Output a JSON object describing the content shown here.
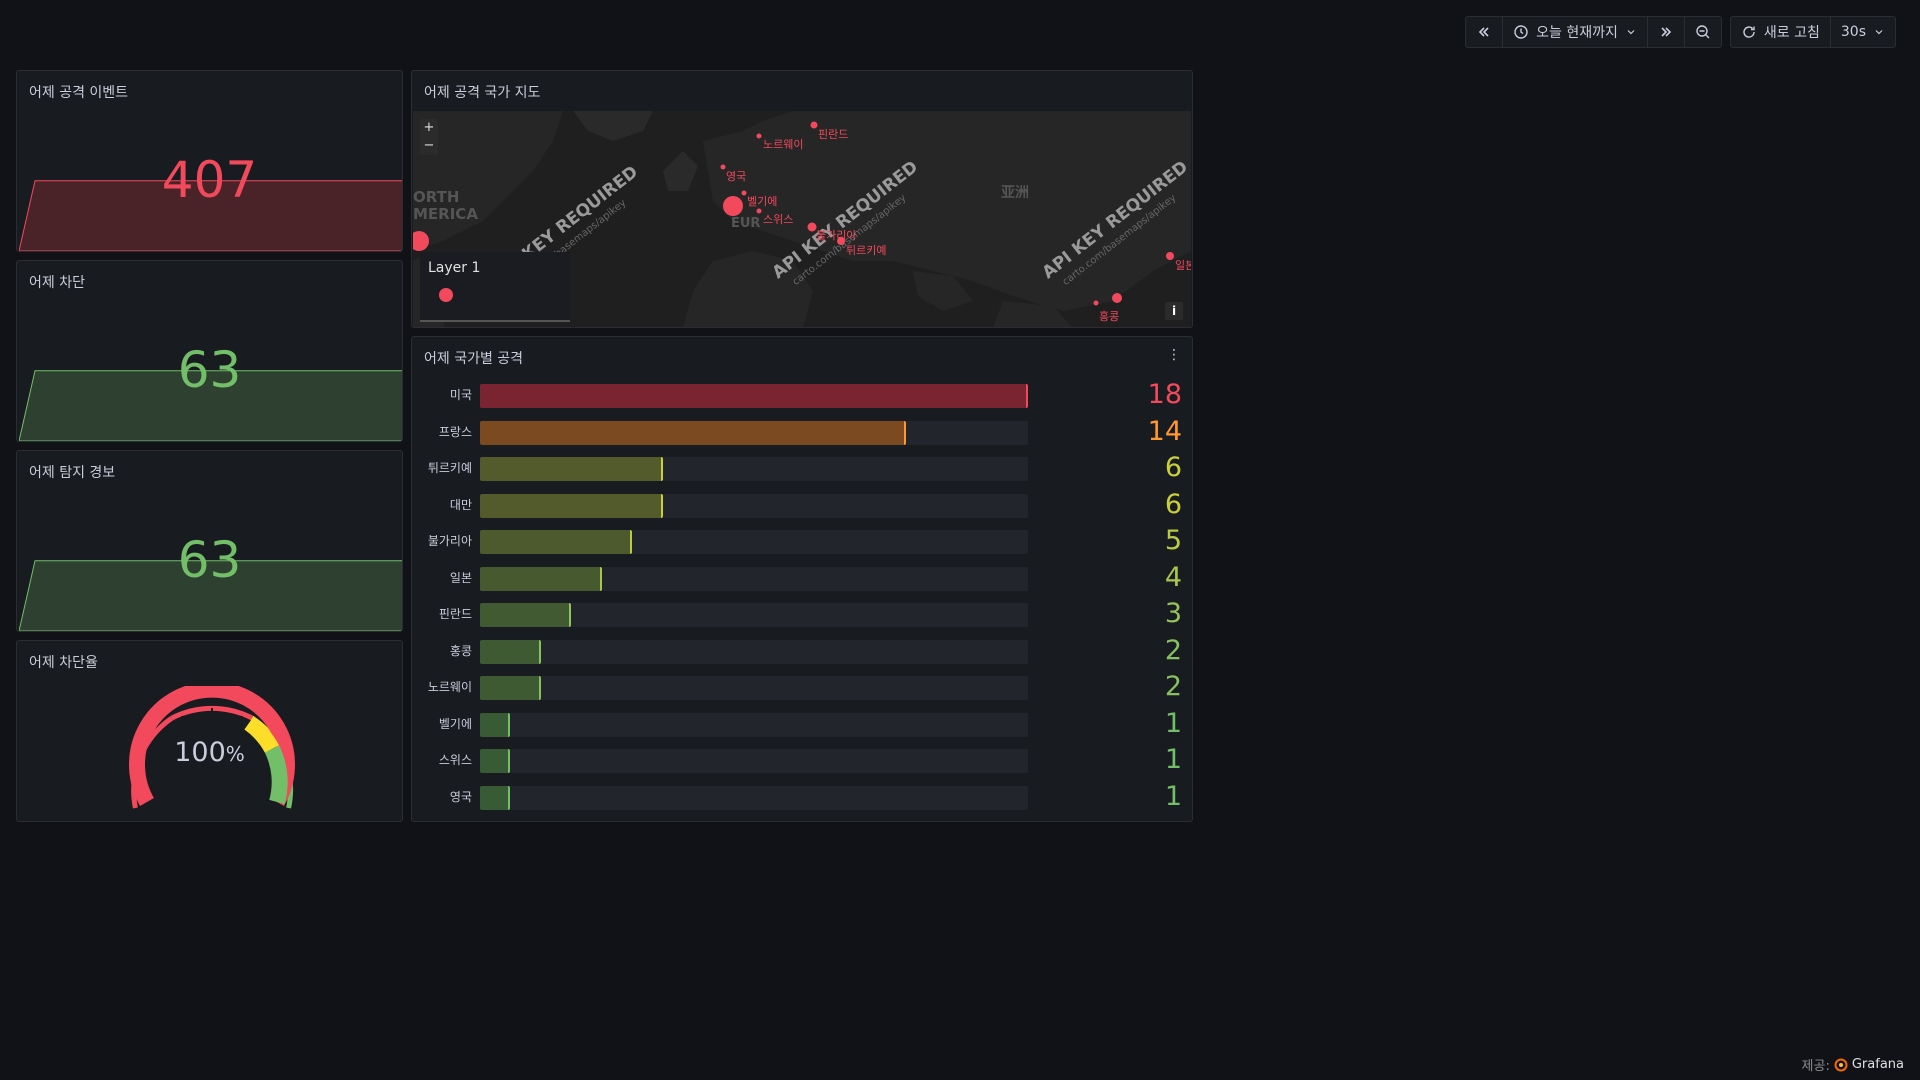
{
  "toolbar": {
    "time_range": "오늘 현재까지",
    "refresh_label": "새로 고침",
    "refresh_interval": "30s"
  },
  "panels": {
    "attack_events": {
      "title": "어제 공격 이벤트",
      "value": "407",
      "color": "#f2495c"
    },
    "blocked": {
      "title": "어제 차단",
      "value": "63",
      "color": "#73bf69"
    },
    "alerts": {
      "title": "어제 탐지 경보",
      "value": "63",
      "color": "#73bf69"
    },
    "block_rate": {
      "title": "어제 차단율",
      "value": "100",
      "unit": "%",
      "percent": 100
    }
  },
  "map": {
    "title": "어제 공격 국가 지도",
    "zoom_in": "+",
    "zoom_out": "−",
    "legend_title": "Layer 1",
    "info": "i",
    "continent_labels": [
      "ORTH",
      "MERICA",
      "EUR",
      "亚洲"
    ],
    "watermark": "API KEY REQUIRED",
    "watermark_sub": "carto.com/basemaps/apikey",
    "markers": [
      "노르웨이",
      "핀란드",
      "영국",
      "벨기에",
      "스위스",
      "불가리아",
      "튀르키예",
      "일본",
      "홍콩"
    ]
  },
  "bars": {
    "title": "어제 국가별 공격",
    "max": 18,
    "rows": [
      {
        "label": "미국",
        "value": 18,
        "color": "#f2495c",
        "fill": "#7a2431"
      },
      {
        "label": "프랑스",
        "value": 14,
        "color": "#ff9830",
        "fill": "#7c4a20"
      },
      {
        "label": "튀르키예",
        "value": 6,
        "color": "#cbd039",
        "fill": "#535a2b"
      },
      {
        "label": "대만",
        "value": 6,
        "color": "#cbd039",
        "fill": "#535a2b"
      },
      {
        "label": "불가리아",
        "value": 5,
        "color": "#b9cb45",
        "fill": "#4d5a2d"
      },
      {
        "label": "일본",
        "value": 4,
        "color": "#a8c64e",
        "fill": "#475a2f"
      },
      {
        "label": "핀란드",
        "value": 3,
        "color": "#96c25a",
        "fill": "#425a31"
      },
      {
        "label": "홍콩",
        "value": 2,
        "color": "#86c060",
        "fill": "#3d5a33"
      },
      {
        "label": "노르웨이",
        "value": 2,
        "color": "#86c060",
        "fill": "#3d5a33"
      },
      {
        "label": "벨기에",
        "value": 1,
        "color": "#73bf69",
        "fill": "#385a34"
      },
      {
        "label": "스위스",
        "value": 1,
        "color": "#73bf69",
        "fill": "#385a34"
      },
      {
        "label": "영국",
        "value": 1,
        "color": "#73bf69",
        "fill": "#385a34"
      }
    ]
  },
  "footer": {
    "provided_by": "제공:",
    "brand": "Grafana"
  }
}
